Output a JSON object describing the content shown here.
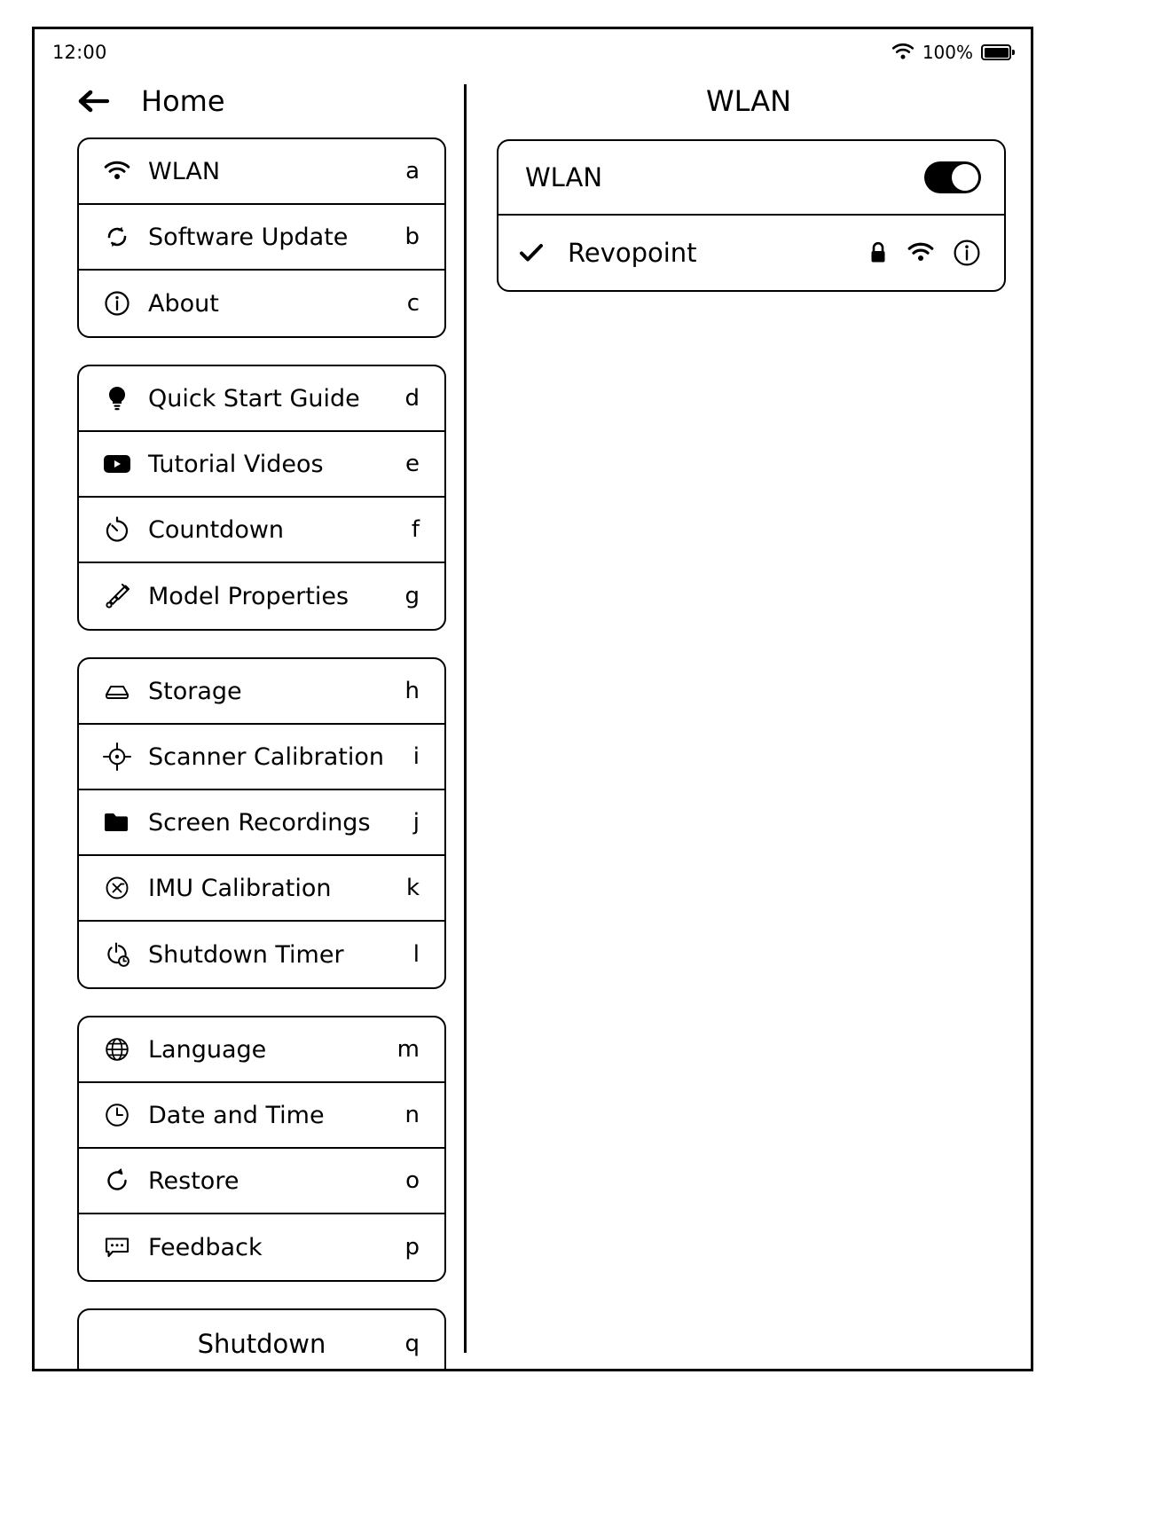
{
  "status_bar": {
    "time": "12:00",
    "battery_percent": "100%",
    "wifi_icon": "wifi-icon",
    "battery_icon": "battery-full-icon"
  },
  "left_pane": {
    "title": "Home",
    "back_icon": "back-arrow-icon",
    "groups": [
      {
        "id": "group-system",
        "items": [
          {
            "label": "WLAN",
            "key": "a",
            "icon": "wifi-icon"
          },
          {
            "label": "Software Update",
            "key": "b",
            "icon": "refresh-sync-icon"
          },
          {
            "label": "About",
            "key": "c",
            "icon": "info-circle-icon"
          }
        ]
      },
      {
        "id": "group-help",
        "items": [
          {
            "label": "Quick Start Guide",
            "key": "d",
            "icon": "lightbulb-icon"
          },
          {
            "label": "Tutorial Videos",
            "key": "e",
            "icon": "video-play-icon"
          },
          {
            "label": "Countdown",
            "key": "f",
            "icon": "stopwatch-icon"
          },
          {
            "label": "Model Properties",
            "key": "g",
            "icon": "paintbrush-icon"
          }
        ]
      },
      {
        "id": "group-device",
        "items": [
          {
            "label": "Storage",
            "key": "h",
            "icon": "hard-drive-icon"
          },
          {
            "label": "Scanner Calibration",
            "key": "i",
            "icon": "crosshair-target-icon"
          },
          {
            "label": "Screen Recordings",
            "key": "j",
            "icon": "folder-icon"
          },
          {
            "label": "IMU Calibration",
            "key": "k",
            "icon": "imu-circle-icon"
          },
          {
            "label": "Shutdown Timer",
            "key": "l",
            "icon": "power-timer-icon"
          }
        ]
      },
      {
        "id": "group-preferences",
        "items": [
          {
            "label": "Language",
            "key": "m",
            "icon": "globe-icon"
          },
          {
            "label": "Date and Time",
            "key": "n",
            "icon": "clock-icon"
          },
          {
            "label": "Restore",
            "key": "o",
            "icon": "restore-arrow-icon"
          },
          {
            "label": "Feedback",
            "key": "p",
            "icon": "chat-bubble-icon"
          }
        ]
      }
    ],
    "shutdown": {
      "label": "Shutdown",
      "key": "q"
    }
  },
  "right_pane": {
    "title": "WLAN",
    "wlan_toggle": {
      "label": "WLAN",
      "state": "on"
    },
    "network": {
      "name": "Revopoint",
      "connected": true,
      "check_icon": "check-icon",
      "lock_icon": "lock-icon",
      "signal_icon": "wifi-icon",
      "info_icon": "info-circle-icon"
    }
  },
  "colors": {
    "foreground": "#000000",
    "background": "#ffffff"
  }
}
